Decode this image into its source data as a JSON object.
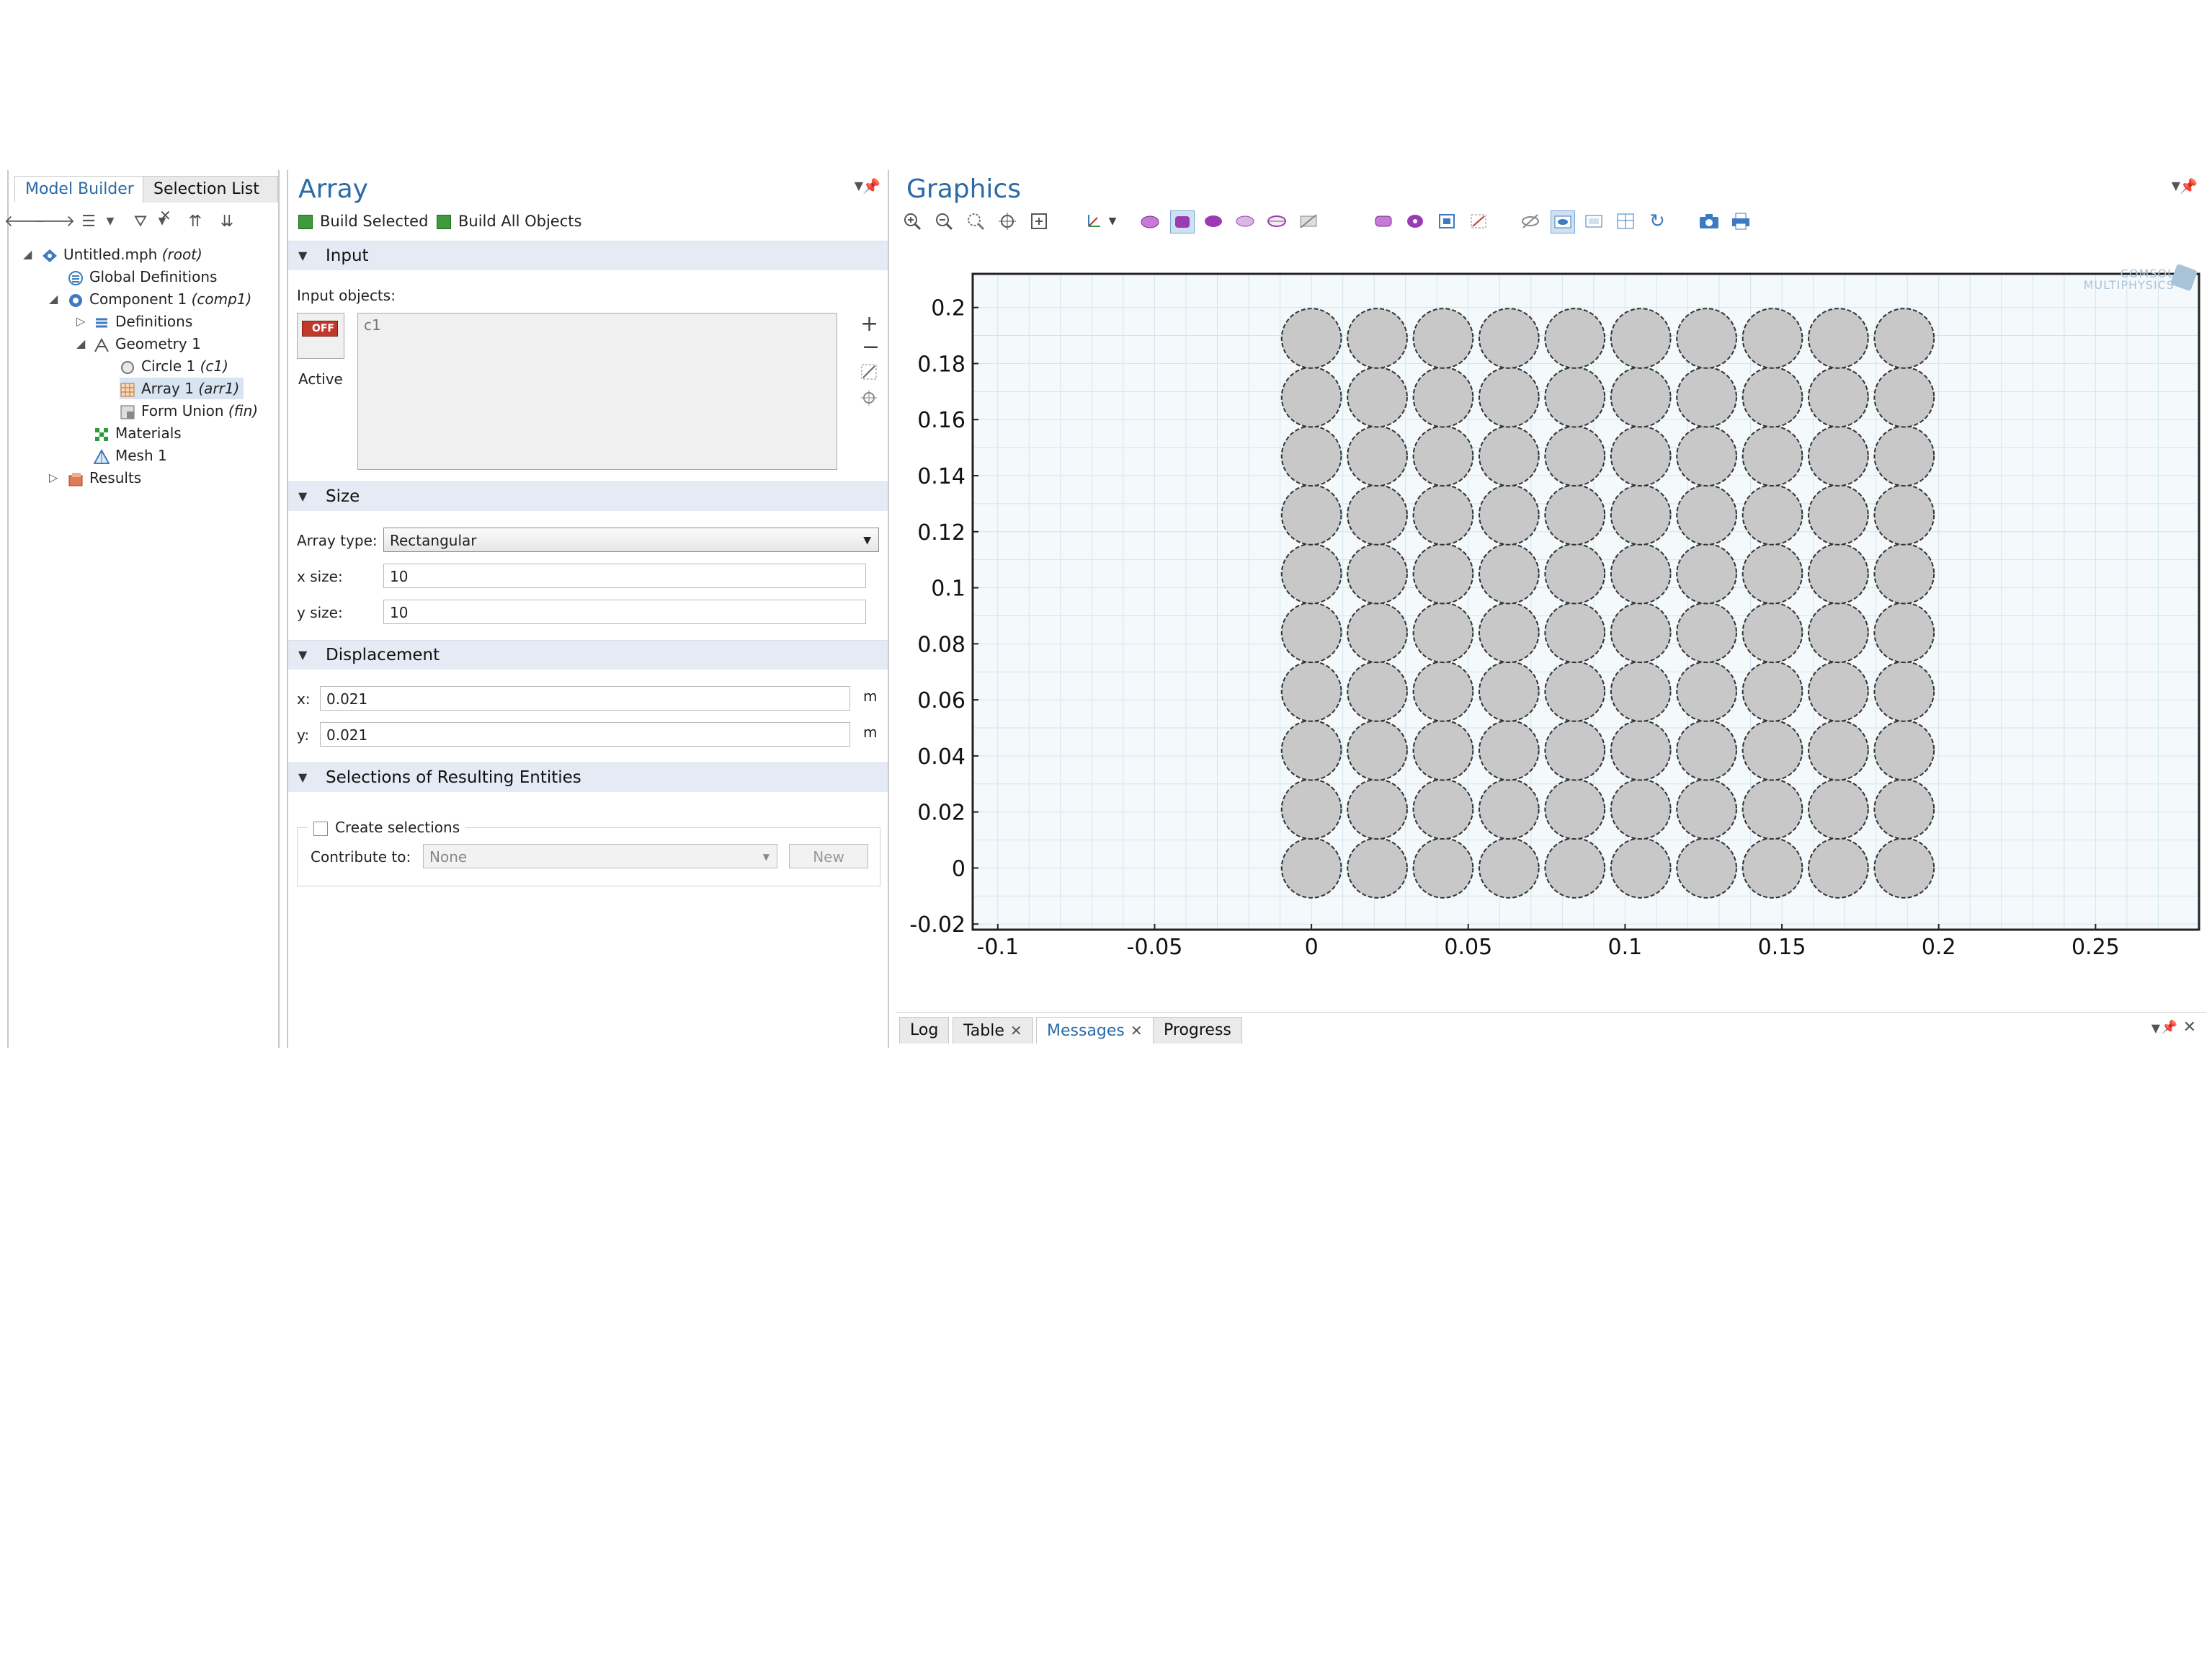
{
  "left_panel": {
    "tabs": [
      {
        "label": "Model Builder"
      },
      {
        "label": "Selection List"
      }
    ],
    "tree": [
      {
        "label": "Untitled.mph",
        "tag": "(root)"
      },
      {
        "label": "Global Definitions",
        "tag": ""
      },
      {
        "label": "Component 1",
        "tag": "(comp1)"
      },
      {
        "label": "Definitions",
        "tag": ""
      },
      {
        "label": "Geometry 1",
        "tag": ""
      },
      {
        "label": "Circle 1",
        "tag": "(c1)"
      },
      {
        "label": "Array 1",
        "tag": "(arr1)"
      },
      {
        "label": "Form Union",
        "tag": "(fin)"
      },
      {
        "label": "Materials",
        "tag": ""
      },
      {
        "label": "Mesh 1",
        "tag": ""
      },
      {
        "label": "Results",
        "tag": ""
      }
    ]
  },
  "settings": {
    "title": "Array",
    "build_selected": "Build Selected",
    "build_all": "Build All Objects",
    "input_section": "Input",
    "input_objects_label": "Input objects:",
    "active_toggle": "OFF",
    "active_label": "Active",
    "input_item": "c1",
    "size_section": "Size",
    "array_type_label": "Array type:",
    "array_type_value": "Rectangular",
    "x_size_label": "x size:",
    "x_size_value": "10",
    "y_size_label": "y size:",
    "y_size_value": "10",
    "displacement_section": "Displacement",
    "disp_x_label": "x:",
    "disp_x_value": "0.021",
    "disp_y_label": "y:",
    "disp_y_value": "0.021",
    "unit": "m",
    "selections_section": "Selections of Resulting Entities",
    "create_selections_label": "Create selections",
    "contribute_label": "Contribute to:",
    "contribute_value": "None",
    "new_button": "New"
  },
  "graphics": {
    "title": "Graphics",
    "watermark_line1": "COMSOL",
    "watermark_line2": "MULTIPHYSICS",
    "x_ticks": [
      "-0.1",
      "-0.05",
      "0",
      "0.05",
      "0.1",
      "0.15",
      "0.2",
      "0.25"
    ],
    "y_ticks": [
      "0.2",
      "0.18",
      "0.16",
      "0.14",
      "0.12",
      "0.1",
      "0.08",
      "0.06",
      "0.04",
      "0.02",
      "0",
      "-0.02"
    ],
    "array": {
      "rows": 10,
      "cols": 10,
      "pitch_m": 0.021,
      "radius_m": 0.0095,
      "origin_m": [
        0,
        0
      ]
    },
    "fill_color": "#c8c8c8",
    "grid_color": "#d4e4ee",
    "background_color": "#f4f9fc"
  },
  "bottom_tabs": [
    {
      "label": "Log"
    },
    {
      "label": "Table"
    },
    {
      "label": "Messages"
    },
    {
      "label": "Progress"
    }
  ],
  "colors": {
    "accent": "#2b6aa6",
    "section_bg": "#e4ebf4"
  }
}
